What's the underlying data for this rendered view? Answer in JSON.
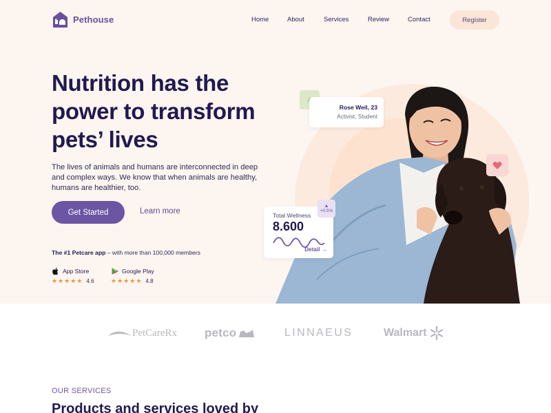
{
  "brand": {
    "name": "Pethouse",
    "accent": "#6c55a3"
  },
  "nav": {
    "items": [
      "Home",
      "About",
      "Services",
      "Review",
      "Contact"
    ],
    "register_label": "Register"
  },
  "hero": {
    "headline": "Nutrition has the power to transform pets’ lives",
    "subtext": "The lives of animals and humans are interconnected in deep and complex ways. We know that when animals are healthy, humans are healthier, too.",
    "cta_primary": "Get Started",
    "cta_secondary": "Learn more",
    "members_bold": "The #1 Petcare app",
    "members_rest": " – with more than 100,000 members",
    "stores": [
      {
        "name": "App Store",
        "icon": "apple-icon",
        "rating": "4.6",
        "stars": 5
      },
      {
        "name": "Google Play",
        "icon": "google-play-icon",
        "rating": "4.8",
        "stars": 5
      }
    ]
  },
  "profile_card": {
    "name": "Rose Weil, 23",
    "role": "Activist, Student"
  },
  "wellness_card": {
    "label": "Total Wellness",
    "value": "8.600",
    "detail": "Detail →",
    "change": "+0.5%"
  },
  "partners": [
    "PetCareRx",
    "petco",
    "LINNAEUS",
    "Walmart"
  ],
  "services": {
    "label": "OUR SERVICES",
    "title": "Products and services loved by"
  },
  "colors": {
    "hero_bg": "#fdf5f0",
    "primary": "#6c55a3",
    "heading": "#21194f",
    "star": "#f0923a",
    "register_bg": "#fbe5d6"
  }
}
